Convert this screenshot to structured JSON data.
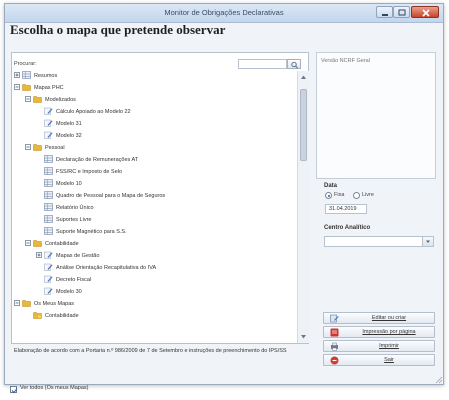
{
  "window": {
    "title": "Monitor de Obrigações Declarativas"
  },
  "heading": "Escolha o mapa que pretende observar",
  "search": {
    "label": "Procurar:"
  },
  "tree": [
    {
      "label": "Resumos",
      "level": 0,
      "kind": "grid",
      "expander": "+"
    },
    {
      "label": "Mapas PHC",
      "level": 0,
      "kind": "folder",
      "expander": "−"
    },
    {
      "label": "Modelizados",
      "level": 1,
      "kind": "folder",
      "expander": "−"
    },
    {
      "label": "Cálculo Apoiado ao Modelo 22",
      "level": 2,
      "kind": "pencil"
    },
    {
      "label": "Modelo 31",
      "level": 2,
      "kind": "pencil"
    },
    {
      "label": "Modelo 32",
      "level": 2,
      "kind": "pencil"
    },
    {
      "label": "Pessoal",
      "level": 1,
      "kind": "folder",
      "expander": "−"
    },
    {
      "label": "Declaração de Remunerações AT",
      "level": 2,
      "kind": "grid"
    },
    {
      "label": "FSS/RC e Imposto de Selo",
      "level": 2,
      "kind": "grid"
    },
    {
      "label": "Modelo 10",
      "level": 2,
      "kind": "grid"
    },
    {
      "label": "Quadro de Pessoal para o Mapa de Seguros",
      "level": 2,
      "kind": "grid"
    },
    {
      "label": "Relatório Único",
      "level": 2,
      "kind": "grid"
    },
    {
      "label": "Suportes Livre",
      "level": 2,
      "kind": "grid"
    },
    {
      "label": "Suporte Magnético para S.S.",
      "level": 2,
      "kind": "grid"
    },
    {
      "label": "Contabilidade",
      "level": 1,
      "kind": "folder",
      "expander": "−"
    },
    {
      "label": "Mapas de Gestão",
      "level": 2,
      "kind": "pencil",
      "expander": "+"
    },
    {
      "label": "Análise Orientação Recapitulativa do IVA",
      "level": 2,
      "kind": "pencil"
    },
    {
      "label": "Decreto Fiscal",
      "level": 2,
      "kind": "pencil"
    },
    {
      "label": "Modelo 30",
      "level": 2,
      "kind": "pencil"
    },
    {
      "label": "Os Meus Mapas",
      "level": 0,
      "kind": "folder",
      "expander": "−"
    },
    {
      "label": "Contabilidade",
      "level": 1,
      "kind": "folder-star"
    }
  ],
  "description": "Elaboração de acordo com a Portaria n.º 986/2009 de 7 de Setembro e instruções de preenchimento do IPS/SS",
  "right_panel": {
    "top_label": "Versão NCRF Geral",
    "data_label": "Data",
    "radio_fixa": "Fixa",
    "radio_livre": "Livre",
    "date_value": "31.04.2019",
    "centro_label": "Centro Analítico"
  },
  "buttons": {
    "edit": "Editar ou criar",
    "impressao": "Impressão por página",
    "imprimir": "Imprimir",
    "sair": "Sair"
  },
  "bottom": {
    "checkbox_label": "Ver todos (Os meus Mapas)"
  },
  "colors": {
    "folder": "#e9b73a",
    "grid_icon": "#6f84a6",
    "pencil_icon": "#4e76b9",
    "accent": "#1b5fb5"
  }
}
